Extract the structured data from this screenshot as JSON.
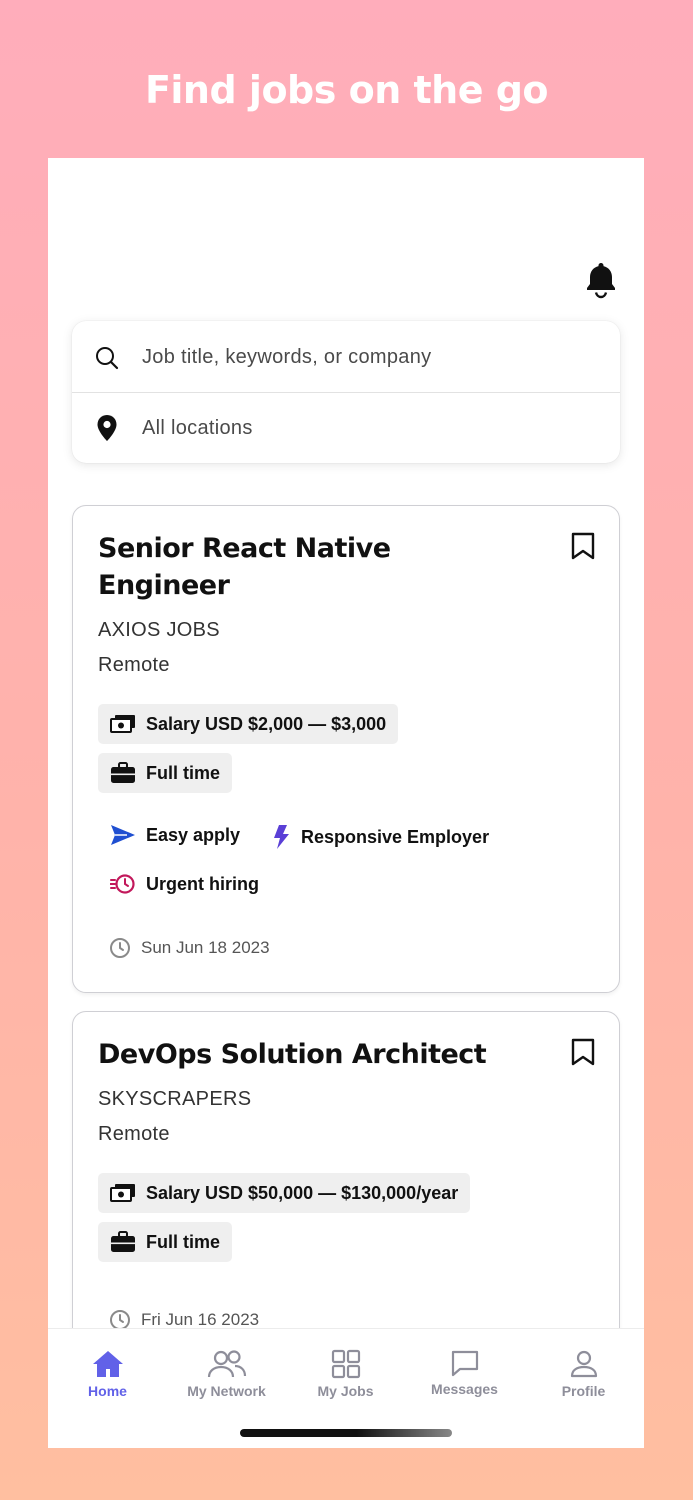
{
  "headline": "Find jobs on the go",
  "search": {
    "keyword_placeholder": "Job title, keywords, or company",
    "location_value": "All locations"
  },
  "jobs": [
    {
      "title": "Senior React Native Engineer",
      "company": "AXIOS JOBS",
      "location": "Remote",
      "salary": "Salary USD $2,000 — $3,000",
      "type": "Full time",
      "features": [
        "Easy apply",
        "Responsive Employer",
        "Urgent hiring"
      ],
      "date": "Sun Jun 18 2023"
    },
    {
      "title": "DevOps Solution Architect",
      "company": "SKYSCRAPERS",
      "location": "Remote",
      "salary": "Salary USD $50,000 — $130,000/year",
      "type": "Full time",
      "date": "Fri Jun 16 2023"
    }
  ],
  "tabs": [
    {
      "label": "Home",
      "icon": "home-icon",
      "active": true
    },
    {
      "label": "My Network",
      "icon": "people-icon"
    },
    {
      "label": "My Jobs",
      "icon": "grid-icon"
    },
    {
      "label": "Messages",
      "icon": "chat-icon"
    },
    {
      "label": "Profile",
      "icon": "person-icon"
    }
  ],
  "colors": {
    "accent": "#6161e8",
    "easy_apply": "#1f4fd1",
    "responsive": "#5a3fd6",
    "urgent": "#c2185b"
  }
}
